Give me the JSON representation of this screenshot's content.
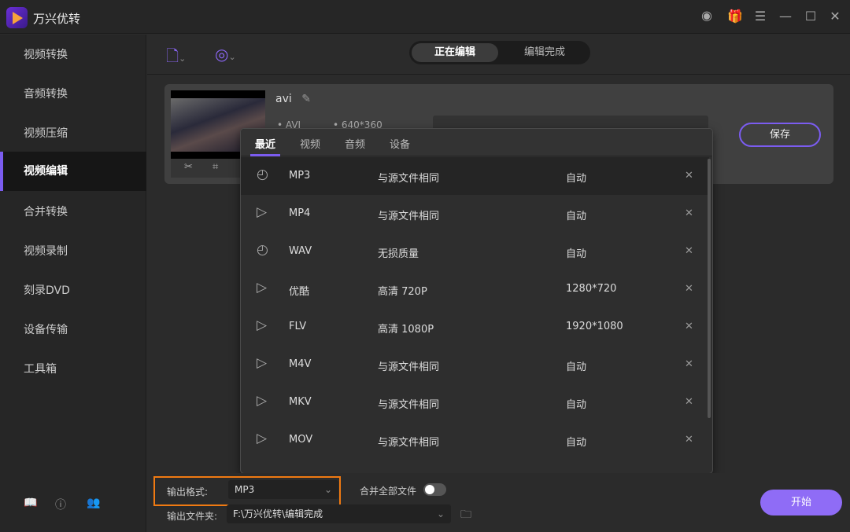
{
  "app": {
    "title": "万兴优转"
  },
  "titlebar": {
    "icons": [
      "account-icon",
      "gift-icon",
      "menu-icon",
      "minimize-icon",
      "maximize-icon",
      "close-icon"
    ]
  },
  "sidebar": {
    "items": [
      {
        "label": "视频转换"
      },
      {
        "label": "音频转换"
      },
      {
        "label": "视频压缩"
      },
      {
        "label": "视频编辑"
      },
      {
        "label": "合并转换"
      },
      {
        "label": "视频录制"
      },
      {
        "label": "刻录DVD"
      },
      {
        "label": "设备传输"
      },
      {
        "label": "工具箱"
      }
    ],
    "active_index": 3
  },
  "toolbar": {
    "tabs": [
      "正在编辑",
      "编辑完成"
    ]
  },
  "file": {
    "name": "avi",
    "format": "AVI",
    "resolution": "640*360",
    "save_label": "保存"
  },
  "popup": {
    "tabs": [
      "最近",
      "视频",
      "音频",
      "设备"
    ],
    "rows": [
      {
        "icon": "audio",
        "format": "MP3",
        "quality": "与源文件相同",
        "resolution": "自动"
      },
      {
        "icon": "video",
        "format": "MP4",
        "quality": "与源文件相同",
        "resolution": "自动"
      },
      {
        "icon": "audio",
        "format": "WAV",
        "quality": "无损质量",
        "resolution": "自动"
      },
      {
        "icon": "video",
        "format": "优酷",
        "quality": "高清 720P",
        "resolution": "1280*720"
      },
      {
        "icon": "video",
        "format": "FLV",
        "quality": "高清 1080P",
        "resolution": "1920*1080"
      },
      {
        "icon": "video",
        "format": "M4V",
        "quality": "与源文件相同",
        "resolution": "自动"
      },
      {
        "icon": "video",
        "format": "MKV",
        "quality": "与源文件相同",
        "resolution": "自动"
      },
      {
        "icon": "video",
        "format": "MOV",
        "quality": "与源文件相同",
        "resolution": "自动"
      }
    ]
  },
  "bottom": {
    "format_label": "输出格式:",
    "format_value": "MP3",
    "merge_label": "合并全部文件",
    "merge_on": false,
    "folder_label": "输出文件夹:",
    "folder_value": "F:\\万兴优转\\编辑完成",
    "start_label": "开始"
  },
  "colors": {
    "accent": "#7b5cf0",
    "highlight": "#f07a12"
  }
}
